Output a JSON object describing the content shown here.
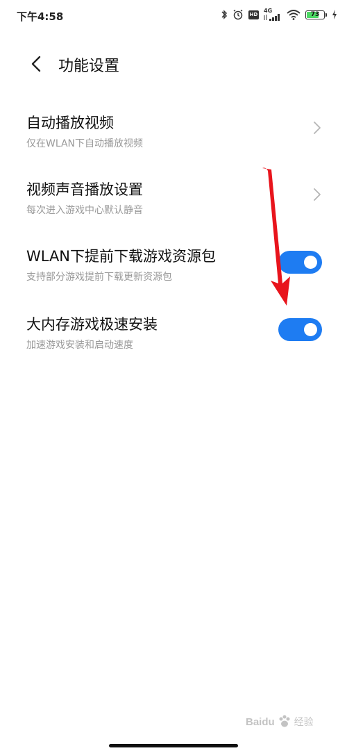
{
  "status_bar": {
    "time": "下午4:58",
    "network": "4G",
    "hd": "HD",
    "battery": "73",
    "battery_level": 0.73
  },
  "header": {
    "title": "功能设置"
  },
  "settings": [
    {
      "title": "自动播放视频",
      "subtitle": "仅在WLAN下自动播放视频",
      "control": "chevron"
    },
    {
      "title": "视频声音播放设置",
      "subtitle": "每次进入游戏中心默认静音",
      "control": "chevron"
    },
    {
      "title": "WLAN下提前下载游戏资源包",
      "subtitle": "支持部分游戏提前下载更新资源包",
      "control": "toggle",
      "on": true
    },
    {
      "title": "大内存游戏极速安装",
      "subtitle": "加速游戏安装和启动速度",
      "control": "toggle",
      "on": true
    }
  ],
  "colors": {
    "toggle_on": "#1e7cf2",
    "annotation_arrow": "#e8141c"
  },
  "watermark": {
    "brand": "Baidu",
    "sub": "经验"
  }
}
